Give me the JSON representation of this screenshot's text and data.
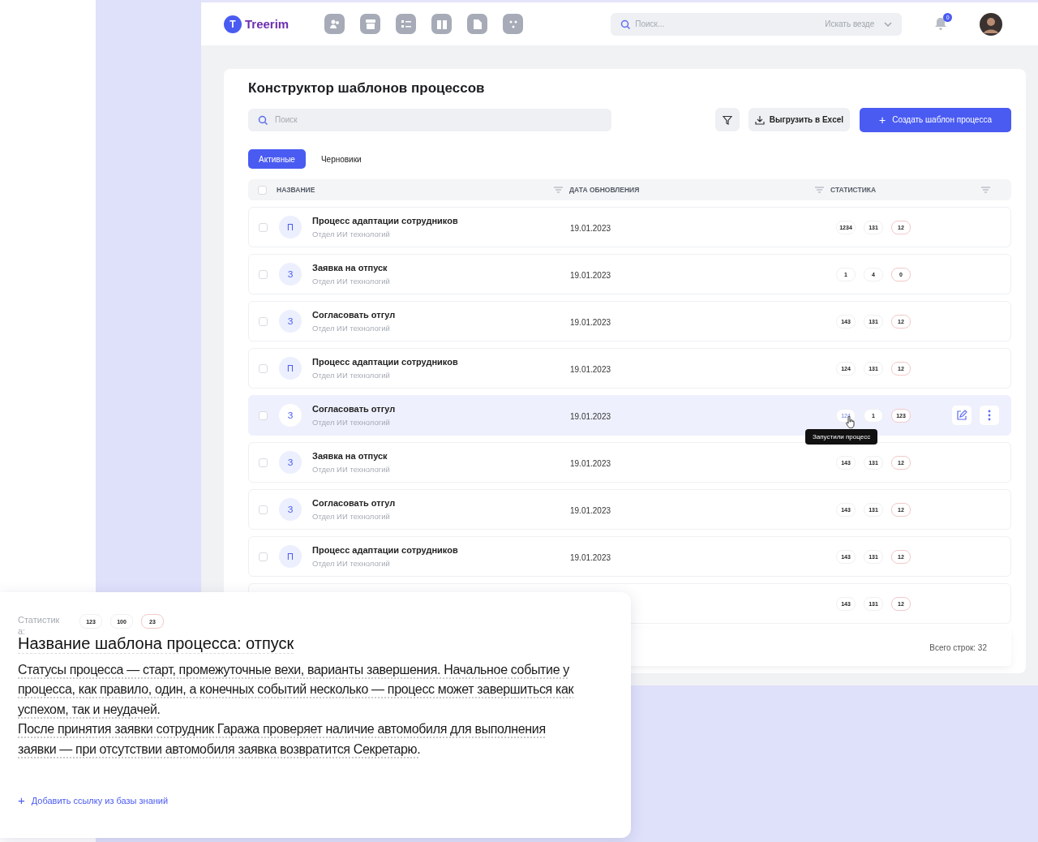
{
  "logo": {
    "letter": "T",
    "name": "Treerim"
  },
  "top_search": {
    "placeholder": "Поиск...",
    "scope": "Искать везде"
  },
  "notifications": {
    "count": "0"
  },
  "page": {
    "title": "Конструктор шаблонов процессов",
    "search_placeholder": "Поиск",
    "export_button": "Выгрузить в Excel",
    "create_button": "Создать шаблон процесса",
    "create_icon": "+"
  },
  "tabs": [
    {
      "label": "Активные",
      "selected": true
    },
    {
      "label": "Черновики",
      "selected": false
    }
  ],
  "table": {
    "select_all_checked": false,
    "columns": [
      "НАЗВАНИЕ",
      "ДАТА ОБНОВЛЕНИЯ",
      "СТАТИСТИКА"
    ],
    "rows": [
      {
        "letter": "П",
        "name": "Процесс адаптации сотрудников",
        "department": "Отдел ИИ технологий",
        "date": "19.01.2023",
        "stats": [
          "1234",
          "131",
          "12"
        ],
        "highlighted": false
      },
      {
        "letter": "З",
        "name": "Заявка на отпуск",
        "department": "Отдел ИИ технологий",
        "date": "19.01.2023",
        "stats": [
          "1",
          "4",
          "0"
        ],
        "highlighted": false
      },
      {
        "letter": "З",
        "name": "Согласовать отгул",
        "department": "Отдел ИИ технологий",
        "date": "19.01.2023",
        "stats": [
          "143",
          "131",
          "12"
        ],
        "highlighted": false
      },
      {
        "letter": "П",
        "name": "Процесс адаптации сотрудников",
        "department": "Отдел ИИ технологий",
        "date": "19.01.2023",
        "stats": [
          "124",
          "131",
          "12"
        ],
        "highlighted": false
      },
      {
        "letter": "З",
        "name": "Согласовать отгул",
        "department": "Отдел ИИ технологий",
        "date": "19.01.2023",
        "stats": [
          "124",
          "1",
          "123"
        ],
        "highlighted": true,
        "tooltip": "Запустили процесс"
      },
      {
        "letter": "З",
        "name": "Заявка на отпуск",
        "department": "Отдел ИИ технологий",
        "date": "19.01.2023",
        "stats": [
          "143",
          "131",
          "12"
        ],
        "highlighted": false
      },
      {
        "letter": "З",
        "name": "Согласовать отгул",
        "department": "Отдел ИИ технологий",
        "date": "19.01.2023",
        "stats": [
          "143",
          "131",
          "12"
        ],
        "highlighted": false
      },
      {
        "letter": "П",
        "name": "Процесс адаптации сотрудников",
        "department": "Отдел ИИ технологий",
        "date": "19.01.2023",
        "stats": [
          "143",
          "131",
          "12"
        ],
        "highlighted": false
      },
      {
        "stats": [
          "143",
          "131",
          "12"
        ],
        "highlighted": false
      }
    ],
    "total": "Всего строк: 32"
  },
  "detail_card": {
    "stats_label": "Статистика:",
    "stats": [
      "123",
      "100",
      "23"
    ],
    "title": "Название шаблона процесса: отпуск",
    "paragraphs": [
      "Статусы процесса — старт, промежуточные вехи, варианты завершения. Начальное событие у процесса, как правило, один, а конечных событий несколько — процесс может завершиться как успехом, так и неудачей.",
      "После принятия заявки сотрудник Гаража проверяет наличие автомобиля для выполнения заявки — при отсутствии автомобиля заявка возвратится Секретарю."
    ],
    "add_link": {
      "icon": "+",
      "label": "Добавить ссылку из базы знаний"
    }
  }
}
